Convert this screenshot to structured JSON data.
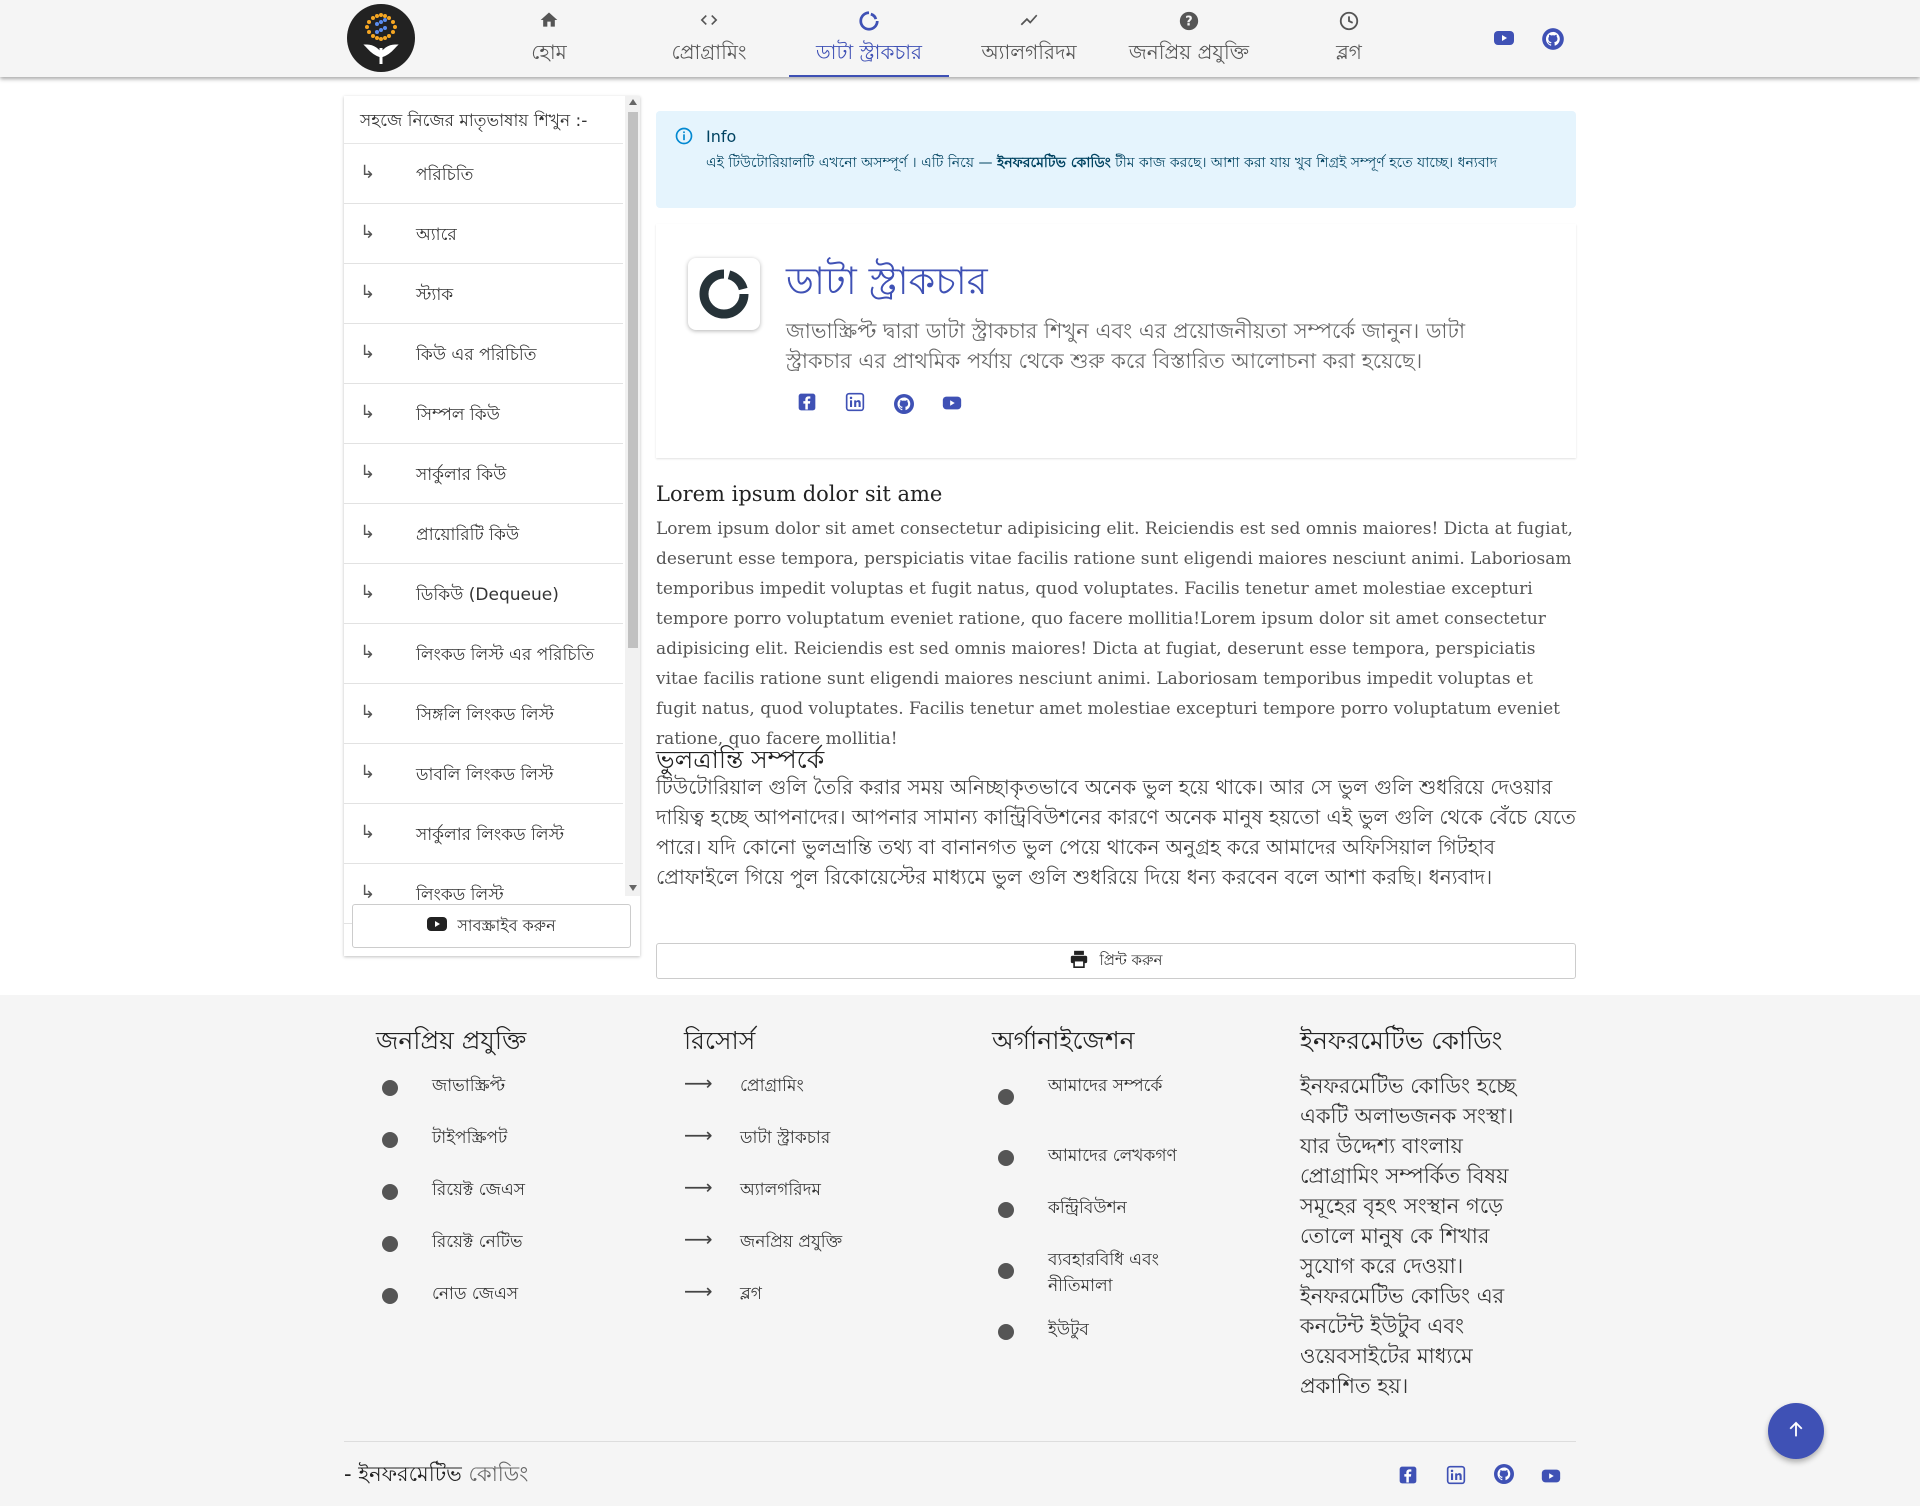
{
  "nav": {
    "items": [
      {
        "label": "হোম",
        "icon": "home-icon"
      },
      {
        "label": "প্রোগ্রামিং",
        "icon": "code-icon"
      },
      {
        "label": "ডাটা স্ট্রাকচার",
        "icon": "loading-ring-icon",
        "active": true
      },
      {
        "label": "অ্যালগরিদম",
        "icon": "trend-icon"
      },
      {
        "label": "জনপ্রিয় প্রযুক্তি",
        "icon": "help-circle-icon"
      },
      {
        "label": "ব্লগ",
        "icon": "clock-icon"
      }
    ],
    "social": [
      "youtube-icon",
      "github-icon"
    ]
  },
  "sidebar": {
    "heading": "সহজে নিজের মাতৃভাষায় শিখুন :-",
    "arrow": "↳",
    "items": [
      "পরিচিতি",
      "অ্যারে",
      "স্ট্যাক",
      "কিউ এর পরিচিতি",
      "সিম্পল কিউ",
      "সার্কুলার কিউ",
      "প্রায়োরিটি কিউ",
      "ডিকিউ (Dequeue)",
      "লিংকড লিস্ট এর পরিচিতি",
      "সিঙ্গলি লিংকড লিস্ট",
      "ডাবলি লিংকড লিস্ট",
      "সার্কুলার লিংকড লিস্ট",
      "লিংকড লিস্ট"
    ],
    "subscribe_label": "সাবস্ক্রাইব করুন"
  },
  "info": {
    "title": "Info",
    "text_before": "এই টিউটোরিয়ালটি এখনো অসম্পূর্ণ । এটি নিয়ে — ",
    "text_bold": "ইনফরমেটিভ কোডিং",
    "text_after": " টীম কাজ করছে। আশা করা যায় খুব শিগ্রই সম্পূর্ণ হতে যাচ্ছে। ধন্যবাদ"
  },
  "card": {
    "title": "ডাটা স্ট্রাকচার",
    "description": "জাভাস্ক্রিপ্ট দ্বারা ডাটা স্ট্রাকচার শিখুন এবং এর প্রয়োজনীয়তা সম্পর্কে জানুন। ডাটা স্ট্রাকচার এর প্রাথমিক পর্যায় থেকে শুরু করে বিস্তারিত আলোচনা করা হয়েছে।",
    "social": [
      "facebook-icon",
      "linkedin-icon",
      "github-icon",
      "youtube-icon"
    ]
  },
  "content": {
    "lorem_heading": "Lorem ipsum dolor sit ame",
    "lorem_text": "Lorem ipsum dolor sit amet consectetur adipisicing elit. Reiciendis est sed omnis maiores! Dicta at fugiat, deserunt esse tempora, perspiciatis vitae facilis ratione sunt eligendi maiores nesciunt animi. Laboriosam temporibus impedit voluptas et fugit natus, quod voluptates. Facilis tenetur amet molestiae excepturi tempore porro voluptatum eveniet ratione, quo facere mollitia!Lorem ipsum dolor sit amet consectetur adipisicing elit. Reiciendis est sed omnis maiores! Dicta at fugiat, deserunt esse tempora, perspiciatis vitae facilis ratione sunt eligendi maiores nesciunt animi. Laboriosam temporibus impedit voluptas et fugit natus, quod voluptates. Facilis tenetur amet molestiae excepturi tempore porro voluptatum eveniet ratione, quo facere mollitia!",
    "errata_heading": "ভুলত্রান্তি সম্পর্কে",
    "errata_text": "টিউটোরিয়াল গুলি তৈরি করার সময় অনিচ্ছাকৃতভাবে অনেক ভুল হয়ে থাকে। আর সে ভুল গুলি শুধরিয়ে দেওয়ার দায়িত্ব হচ্ছে আপনাদের। আপনার সামান্য কান্ট্রিবিউশনের কারণে অনেক মানুষ হয়তো এই ভুল গুলি থেকে বেঁচে যেতে পারে। যদি কোনো ভুলভ্রান্তি তথ্য বা বানানগত ভুল পেয়ে থাকেন অনুগ্রহ করে আমাদের অফিসিয়াল গিটহাব প্রোফাইলে গিয়ে পুল রিকোয়েস্টের মাধ্যমে ভুল গুলি শুধরিয়ে দিয়ে ধন্য করবেন বলে আশা করছি। ধন্যবাদ।",
    "print_label": "প্রিন্ট করুন"
  },
  "footer": {
    "col1": {
      "title": "জনপ্রিয় প্রযুক্তি",
      "items": [
        "জাভাস্ক্রিপ্ট",
        "টাইপস্ক্রিপট",
        "রিয়েক্ট জেএস",
        "রিয়েক্ট নেটিভ",
        "নোড জেএস"
      ]
    },
    "col2": {
      "title": "রিসোর্স",
      "arrow": "⟶",
      "items": [
        "প্রোগ্রামিং",
        "ডাটা স্ট্রাকচার",
        "অ্যালগরিদম",
        "জনপ্রিয় প্রযুক্তি",
        "ব্লগ"
      ]
    },
    "col3": {
      "title": "অর্গানাইজেশন",
      "items": [
        "আমাদের সম্পর্কে",
        "আমাদের লেখকগণ",
        "কন্ট্রিবিউশন",
        "ব্যবহারবিধি এবং নীতিমালা",
        "ইউটুব"
      ]
    },
    "col4": {
      "title": "ইনফরমেটিভ কোডিং",
      "text": "ইনফরমেটিভ কোডিং হচ্ছে একটি অলাভজনক সংস্থা। যার উদ্দেশ্য বাংলায় প্রোগ্রামিং সম্পর্কিত বিষয় সমূহের বৃহৎ সংস্থান গড়ে তোলে মানুষ কে শিখার সুযোগ করে দেওয়া। ইনফরমেটিভ কোডিং এর কনটেন্ট ইউটুব এবং ওয়েবসাইটের মাধ্যমে প্রকাশিত হয়।"
    },
    "brand_prefix": "- ইনফরমেটিভ ",
    "brand_suffix": "কোডিং",
    "social": [
      "facebook-icon",
      "linkedin-icon",
      "github-icon",
      "youtube-icon"
    ]
  },
  "colors": {
    "accent": "#3f51b5",
    "info_bg": "#e5f4fd",
    "footer_bg": "#f5f5f5"
  }
}
